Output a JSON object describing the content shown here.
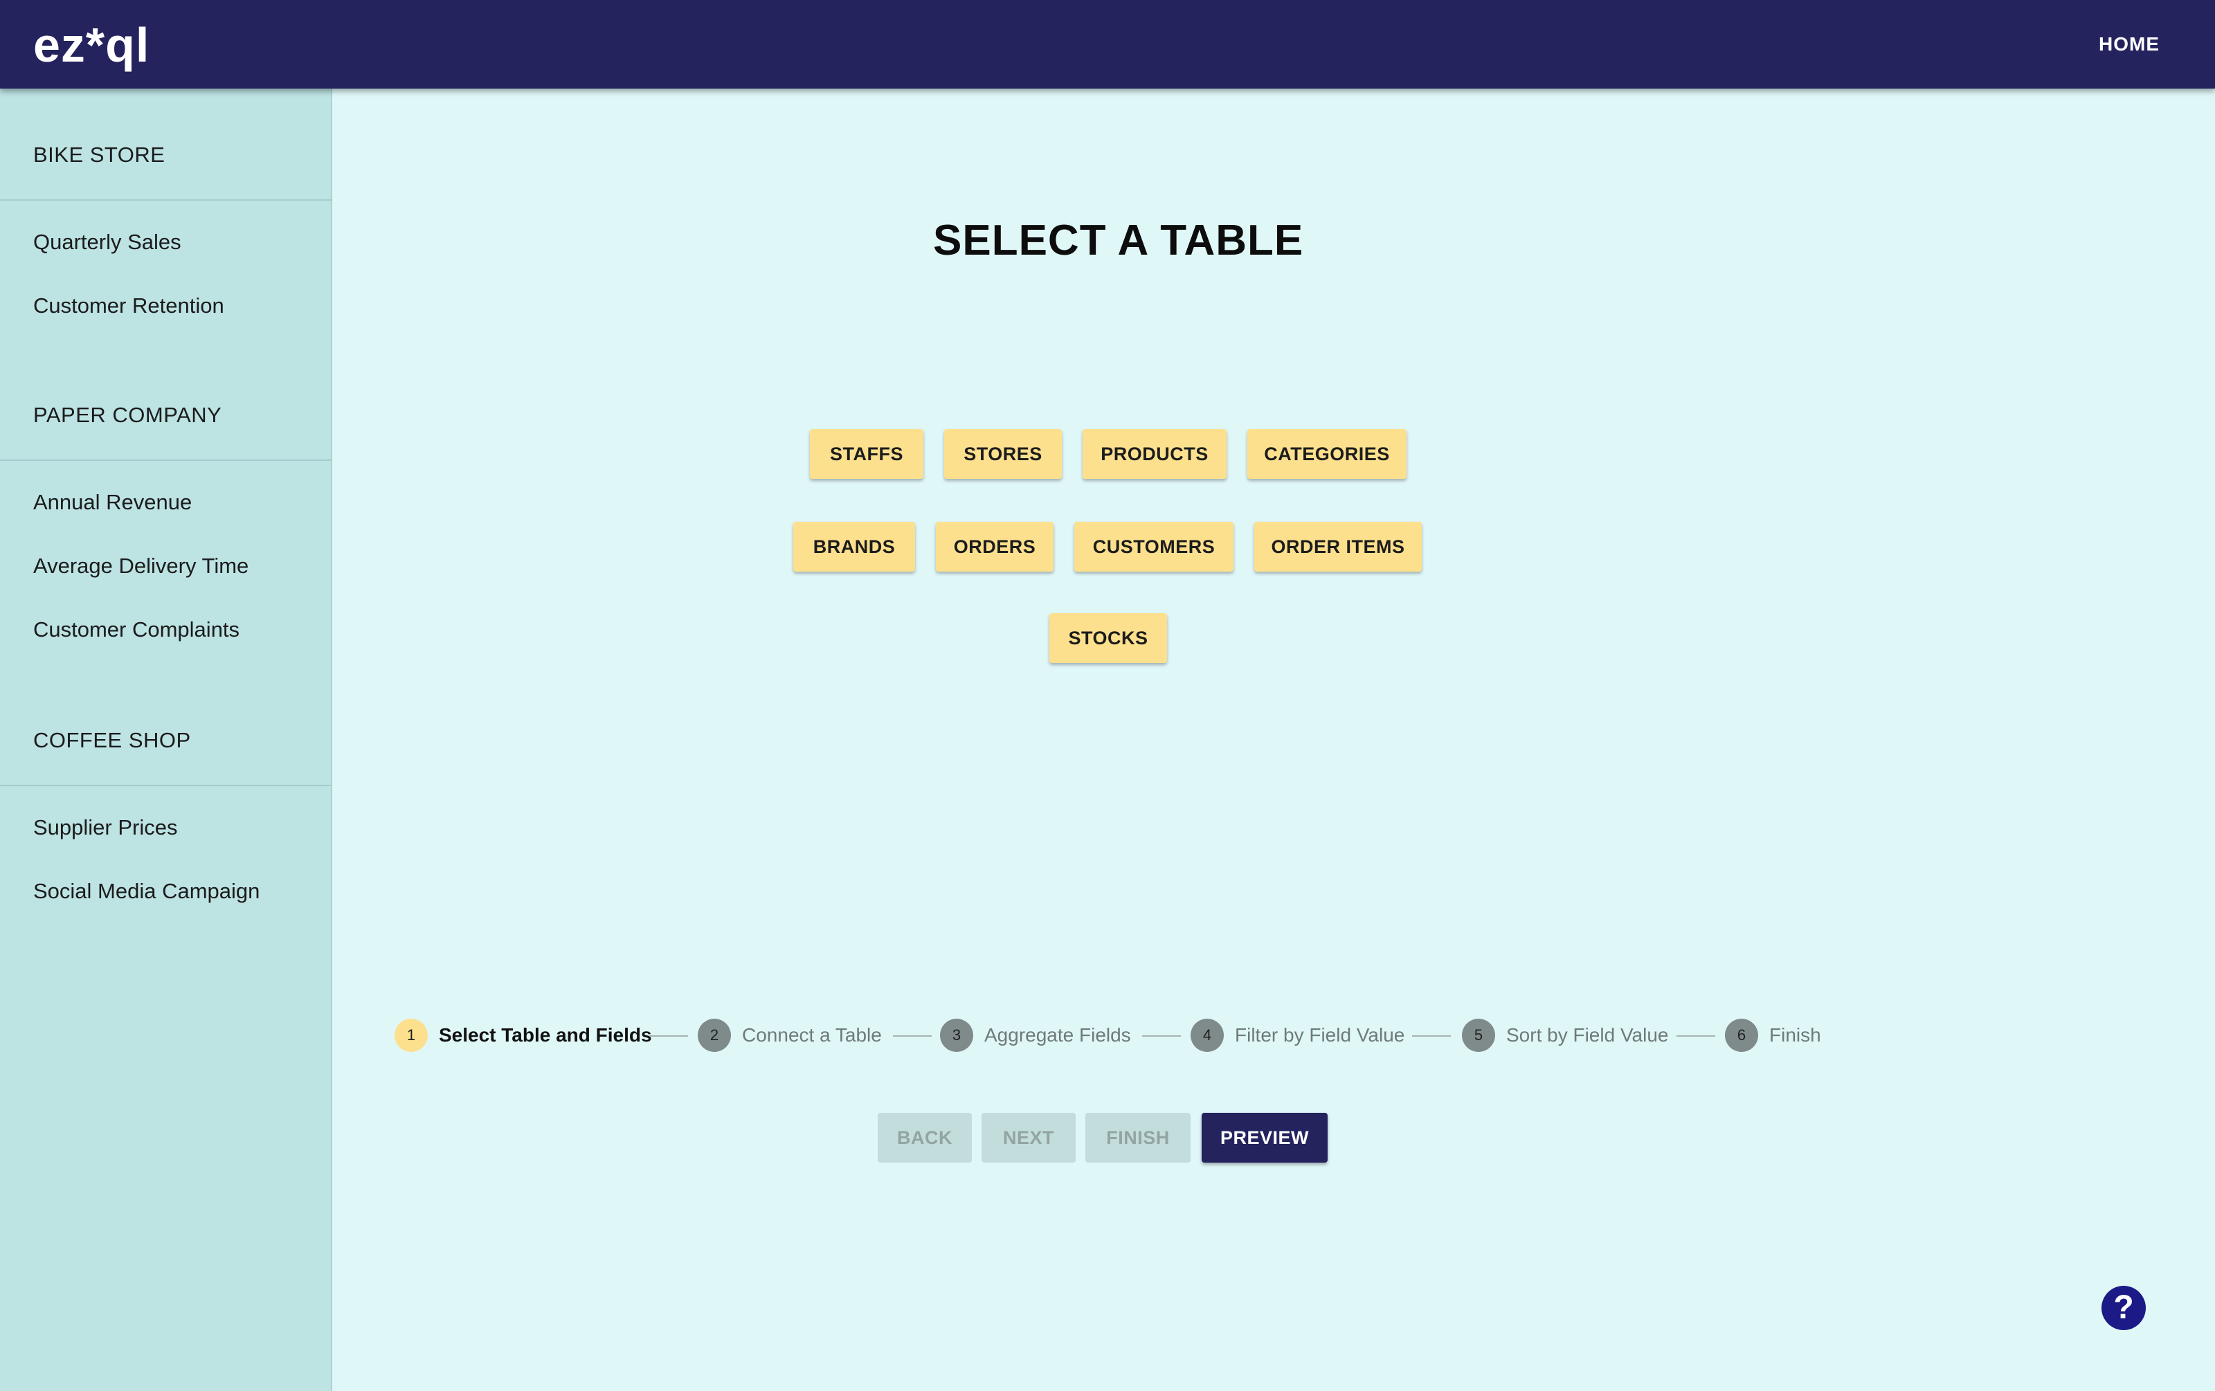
{
  "app": {
    "logo": "ez*ql",
    "home_label": "HOME"
  },
  "sidebar": {
    "groups": [
      {
        "title": "BIKE STORE",
        "items": [
          "Quarterly Sales",
          "Customer Retention"
        ]
      },
      {
        "title": "PAPER COMPANY",
        "items": [
          "Annual Revenue",
          "Average Delivery Time",
          "Customer Complaints"
        ]
      },
      {
        "title": "COFFEE SHOP",
        "items": [
          "Supplier Prices",
          "Social Media Campaign"
        ]
      }
    ]
  },
  "main": {
    "title": "SELECT A TABLE",
    "tables": [
      "STAFFS",
      "STORES",
      "PRODUCTS",
      "CATEGORIES",
      "BRANDS",
      "ORDERS",
      "CUSTOMERS",
      "ORDER ITEMS",
      "STOCKS"
    ]
  },
  "stepper": {
    "active_step": 1,
    "steps": [
      {
        "number": "1",
        "label": "Select Table and Fields"
      },
      {
        "number": "2",
        "label": "Connect a Table"
      },
      {
        "number": "3",
        "label": "Aggregate Fields"
      },
      {
        "number": "4",
        "label": "Filter by Field Value"
      },
      {
        "number": "5",
        "label": "Sort by Field Value"
      },
      {
        "number": "6",
        "label": "Finish"
      }
    ]
  },
  "nav": {
    "back_label": "BACK",
    "next_label": "NEXT",
    "finish_label": "FINISH",
    "preview_label": "PREVIEW"
  },
  "help": {
    "icon": "question-icon",
    "glyph": "?"
  },
  "colors": {
    "appbar": "#24235e",
    "sidebar": "#bde3e3",
    "main_bg": "#e0f7f8",
    "table_button": "#fde08d",
    "primary_button": "#24235e",
    "help_button": "#1b1a86"
  }
}
